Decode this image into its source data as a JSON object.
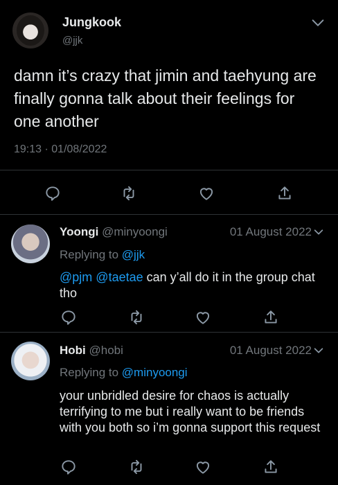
{
  "main": {
    "name": "Jungkook",
    "handle": "@jjk",
    "text": "damn it’s crazy that jimin and taehyung are finally gonna talk about their feelings for one another",
    "time": "19:13",
    "separator": "·",
    "date": "01/08/2022"
  },
  "replies": [
    {
      "name": "Yoongi",
      "handle": "@minyoongi",
      "date": "01 August 2022",
      "replying_prefix": "Replying to",
      "replying_to": "@jjk",
      "mention1": "@pjm",
      "mention2": "@taetae",
      "text": " can y’all do it in the group chat tho"
    },
    {
      "name": "Hobi",
      "handle": "@hobi",
      "date": "01 August 2022",
      "replying_prefix": "Replying to",
      "replying_to": "@minyoongi",
      "text": "your unbridled desire for chaos is actually terrifying to me but i really want to be friends with you both so i’m gonna support this request"
    }
  ],
  "colors": {
    "background": "#000000",
    "text": "#e7e9ea",
    "muted": "#71767b",
    "link": "#1d9bf0",
    "divider": "#2f3336"
  },
  "icons": [
    "reply-icon",
    "retweet-icon",
    "like-icon",
    "share-icon",
    "chevron-down-icon"
  ]
}
